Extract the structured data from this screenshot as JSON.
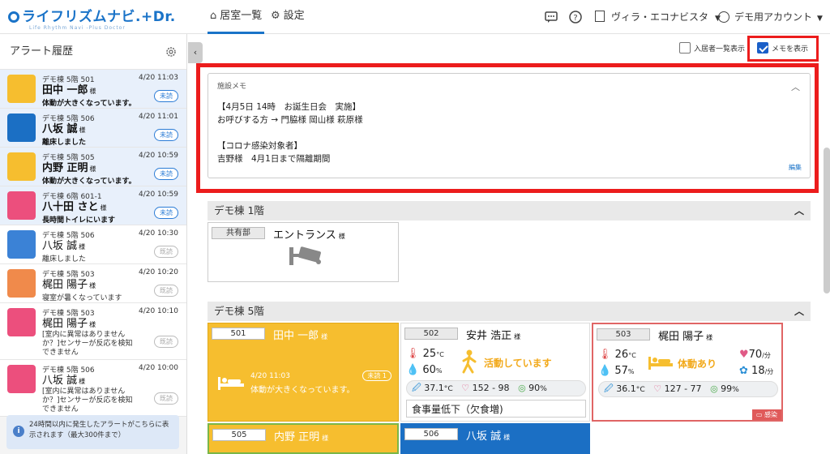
{
  "header": {
    "logo_text": "ライフリズムナビ.+Dr.",
    "logo_sub": "Life Rhythm Navi -Plus Doctor",
    "tab_rooms": "居室一覧",
    "tab_settings": "設定",
    "facility": "ヴィラ・エコナビスタ",
    "account": "デモ用アカウント"
  },
  "sidebar": {
    "title": "アラート履歴",
    "alerts": [
      {
        "location": "デモ棟 5階 501",
        "time": "4/20 11:03",
        "name": "田中 一郎",
        "sama": "様",
        "msg": "体動が大きくなっています。",
        "badge": "未読",
        "color": "#f6be2f",
        "state": "unread"
      },
      {
        "location": "デモ棟 5階 506",
        "time": "4/20 11:01",
        "name": "八坂 誠",
        "sama": "様",
        "msg": "離床しました",
        "badge": "未読",
        "color": "#1b6fc4",
        "state": "unread"
      },
      {
        "location": "デモ棟 5階 505",
        "time": "4/20 10:59",
        "name": "内野 正明",
        "sama": "様",
        "msg": "体動が大きくなっています。",
        "badge": "未読",
        "color": "#f6be2f",
        "state": "unread"
      },
      {
        "location": "デモ棟 6階 601-1",
        "time": "4/20 10:59",
        "name": "八十田 さと",
        "sama": "様",
        "msg": "長時間トイレにいます",
        "badge": "未読",
        "color": "#ec4f7d",
        "state": "unread"
      },
      {
        "location": "デモ棟 5階 506",
        "time": "4/20 10:30",
        "name": "八坂 誠",
        "sama": "様",
        "msg": "離床しました",
        "badge": "既読",
        "color": "#3b82d6",
        "state": "read"
      },
      {
        "location": "デモ棟 5階 503",
        "time": "4/20 10:20",
        "name": "梶田 陽子",
        "sama": "様",
        "msg": "寝室が暑くなっています",
        "badge": "既読",
        "color": "#f08a4b",
        "state": "read"
      },
      {
        "location": "デモ棟 5階 503",
        "time": "4/20 10:10",
        "name": "梶田 陽子",
        "sama": "様",
        "msg": "[室内に異常はありませんか？]センサーが反応を検知できません",
        "badge": "既読",
        "color": "#ec4f7d",
        "state": "read"
      },
      {
        "location": "デモ棟 5階 506",
        "time": "4/20 10:00",
        "name": "八坂 誠",
        "sama": "様",
        "msg": "[室内に異常はありませんか？]センサーが反応を検知できません",
        "badge": "既読",
        "color": "#ec4f7d",
        "state": "read"
      }
    ],
    "note": "24時間以内に発生したアラートがこちらに表示されます（最大300件まで）"
  },
  "main": {
    "chk_residents": "入居者一覧表示",
    "chk_memo": "メモを表示",
    "memo_title": "施設メモ",
    "memo_body": "【4月5日 14時　お誕生日会　実施】\nお呼びする方 → 門脇様 岡山様 萩原様\n\n【コロナ感染対象者】\n吉野様　4月1日まで隔離期間",
    "memo_edit": "編集",
    "floor1": "デモ棟 1階",
    "floor5": "デモ棟 5階",
    "entrance_label": "共有部",
    "entrance_name": "エントランス",
    "sama": "様",
    "room501": {
      "no": "501",
      "name": "田中 一郎",
      "time": "4/20 11:03",
      "msg": "体動が大きくなっています。",
      "badge": "未読 1"
    },
    "room502": {
      "no": "502",
      "name": "安井 浩正",
      "temp": "25",
      "temp_unit": "°C",
      "hum": "60",
      "hum_unit": "%",
      "status": "活動しています",
      "body_temp": "37.1",
      "body_temp_unit": "°C",
      "bp": "152 - 98",
      "spo2": "90",
      "spo2_unit": "%",
      "note": "食事量低下（欠食増)"
    },
    "room503": {
      "no": "503",
      "name": "梶田 陽子",
      "temp": "26",
      "temp_unit": "°C",
      "hum": "57",
      "hum_unit": "%",
      "status": "体動あり",
      "hr": "70",
      "hr_unit": "/分",
      "rr": "18",
      "rr_unit": "/分",
      "body_temp": "36.1",
      "body_temp_unit": "°C",
      "bp": "127 - 77",
      "spo2": "99",
      "spo2_unit": "%",
      "tag": "感染"
    },
    "room505": {
      "no": "505",
      "name": "内野 正明"
    },
    "room506": {
      "no": "506",
      "name": "八坂 誠"
    }
  }
}
